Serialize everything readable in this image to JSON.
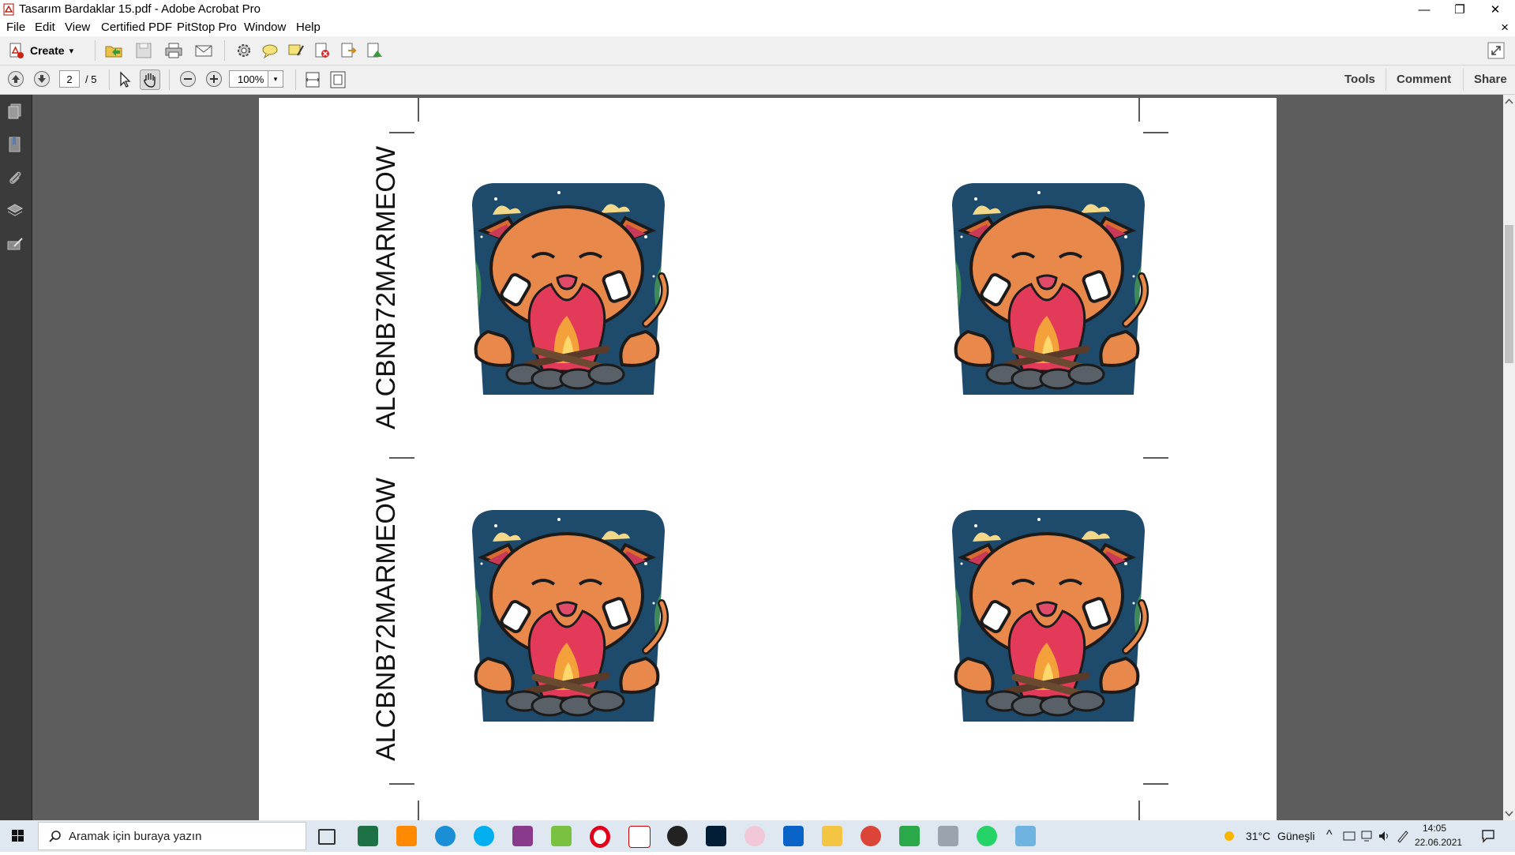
{
  "window": {
    "title": "Tasarım Bardaklar 15.pdf - Adobe Acrobat Pro",
    "minimize_glyph": "—",
    "restore_glyph": "❐",
    "close_glyph": "✕"
  },
  "menubar": {
    "items": [
      "File",
      "Edit",
      "View",
      "Certified PDF",
      "PitStop Pro",
      "Window",
      "Help"
    ],
    "close_doc_glyph": "×"
  },
  "toolbar": {
    "create_label": "Create",
    "create_dropdown_glyph": "▾",
    "icons": [
      "open-icon",
      "save-icon",
      "print-icon",
      "email-icon",
      "settings-icon",
      "comment-icon",
      "highlight-icon",
      "redact-icon",
      "export-icon",
      "combine-icon",
      "fullscreen-icon"
    ]
  },
  "navigation": {
    "current_page": "2",
    "total_pages": "/ 5",
    "zoom": "100%",
    "zoom_dropdown_glyph": "▾"
  },
  "right_panel_links": {
    "tools": "Tools",
    "comment": "Comment",
    "share": "Share"
  },
  "left_pane_icons": [
    "pages-icon",
    "bookmarks-icon",
    "attachments-icon",
    "layers-icon",
    "signatures-icon"
  ],
  "document": {
    "vertical_label_top": "ALCBNB72MARMEOW",
    "vertical_label_bottom": "ALCBNB72MARMEOW",
    "sticker_subject": "orange cat roasting marshmallows over campfire",
    "sticker_count": 4,
    "colors": {
      "sky": "#1e4a6b",
      "grass": "#3f8a5a",
      "cat": "#e8884a",
      "fire": "#e23a58",
      "stones": "#5a6068"
    }
  },
  "scrollbar": {
    "position_fraction": 0.2
  },
  "taskbar": {
    "search_placeholder": "Aramak için buraya yazın",
    "weather_temp": "31°C",
    "weather_desc": "Güneşli",
    "tray_up_glyph": "^",
    "time": "14:05",
    "date": "22.06.2021",
    "apps": [
      "task-view",
      "excel",
      "illustrator",
      "edge",
      "skype",
      "winrar",
      "app-green",
      "opera",
      "acrobat",
      "app-dark",
      "photoshop",
      "paint-app",
      "outlook",
      "file-explorer",
      "chrome",
      "app-green-2",
      "printer-app",
      "whatsapp",
      "app-blue"
    ],
    "accent": "#0078d7"
  }
}
